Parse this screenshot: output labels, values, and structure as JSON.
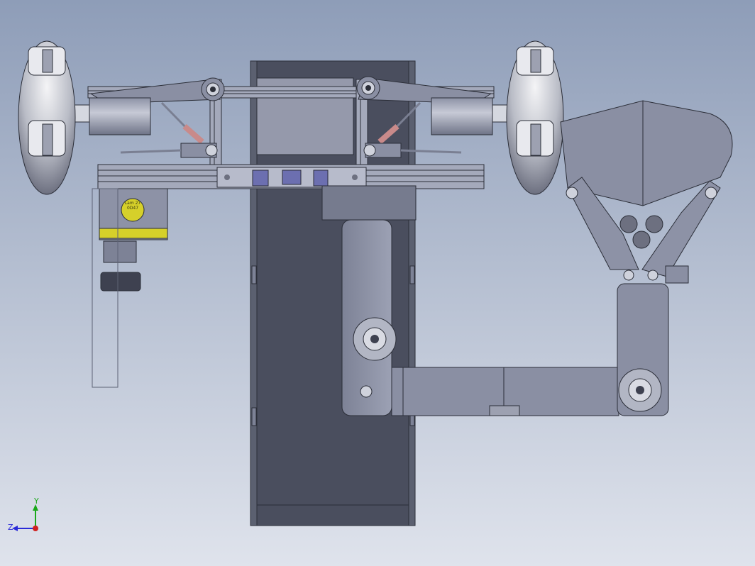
{
  "viewport": {
    "background_top": "#8e9db8",
    "background_bottom": "#dfe3ec"
  },
  "colors": {
    "metal": "#9fa5b8",
    "metal_dark": "#5d6275",
    "belt": "#4a4e5e",
    "arm": "#8a8fa3",
    "accent_yellow": "#d6d02a",
    "accent_purple": "#6c6fb0",
    "spring_red": "#c98a8a"
  },
  "nameplate": {
    "line1": "Lam 27",
    "line2": "0D47"
  },
  "triad": {
    "y_label": "Y",
    "z_label": "Z",
    "y_color": "#1aa81a",
    "z_color": "#2a2ad8",
    "origin_color": "#d02020"
  }
}
